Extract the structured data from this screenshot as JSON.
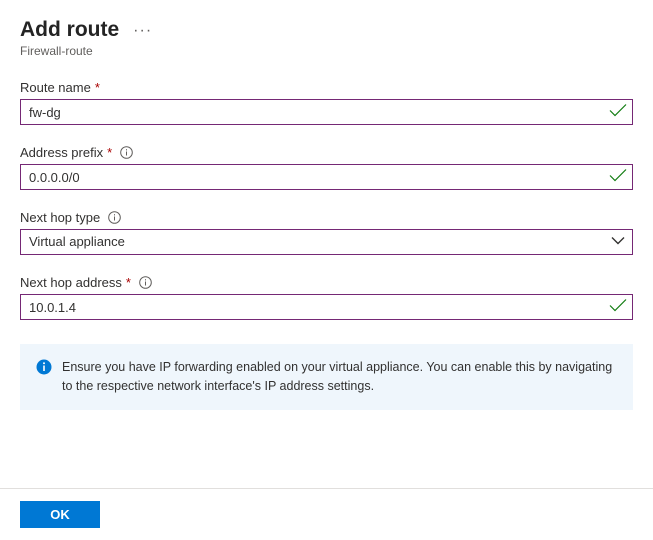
{
  "header": {
    "title": "Add route",
    "subtitle": "Firewall-route"
  },
  "fields": {
    "routeName": {
      "label": "Route name",
      "required": true,
      "info": false,
      "value": "fw-dg",
      "valid": true
    },
    "addressPrefix": {
      "label": "Address prefix",
      "required": true,
      "info": true,
      "value": "0.0.0.0/0",
      "valid": true
    },
    "nextHopType": {
      "label": "Next hop type",
      "required": false,
      "info": true,
      "value": "Virtual appliance"
    },
    "nextHopAddress": {
      "label": "Next hop address",
      "required": true,
      "info": true,
      "value": "10.0.1.4",
      "valid": true
    }
  },
  "infoBox": {
    "text": "Ensure you have IP forwarding enabled on your virtual appliance. You can enable this by navigating to the respective network interface's IP address settings."
  },
  "footer": {
    "okLabel": "OK"
  },
  "colors": {
    "primary": "#0078d4",
    "inputBorder": "#752875",
    "validGreen": "#107c10",
    "infoBg": "#eff6fc",
    "required": "#a80000"
  }
}
